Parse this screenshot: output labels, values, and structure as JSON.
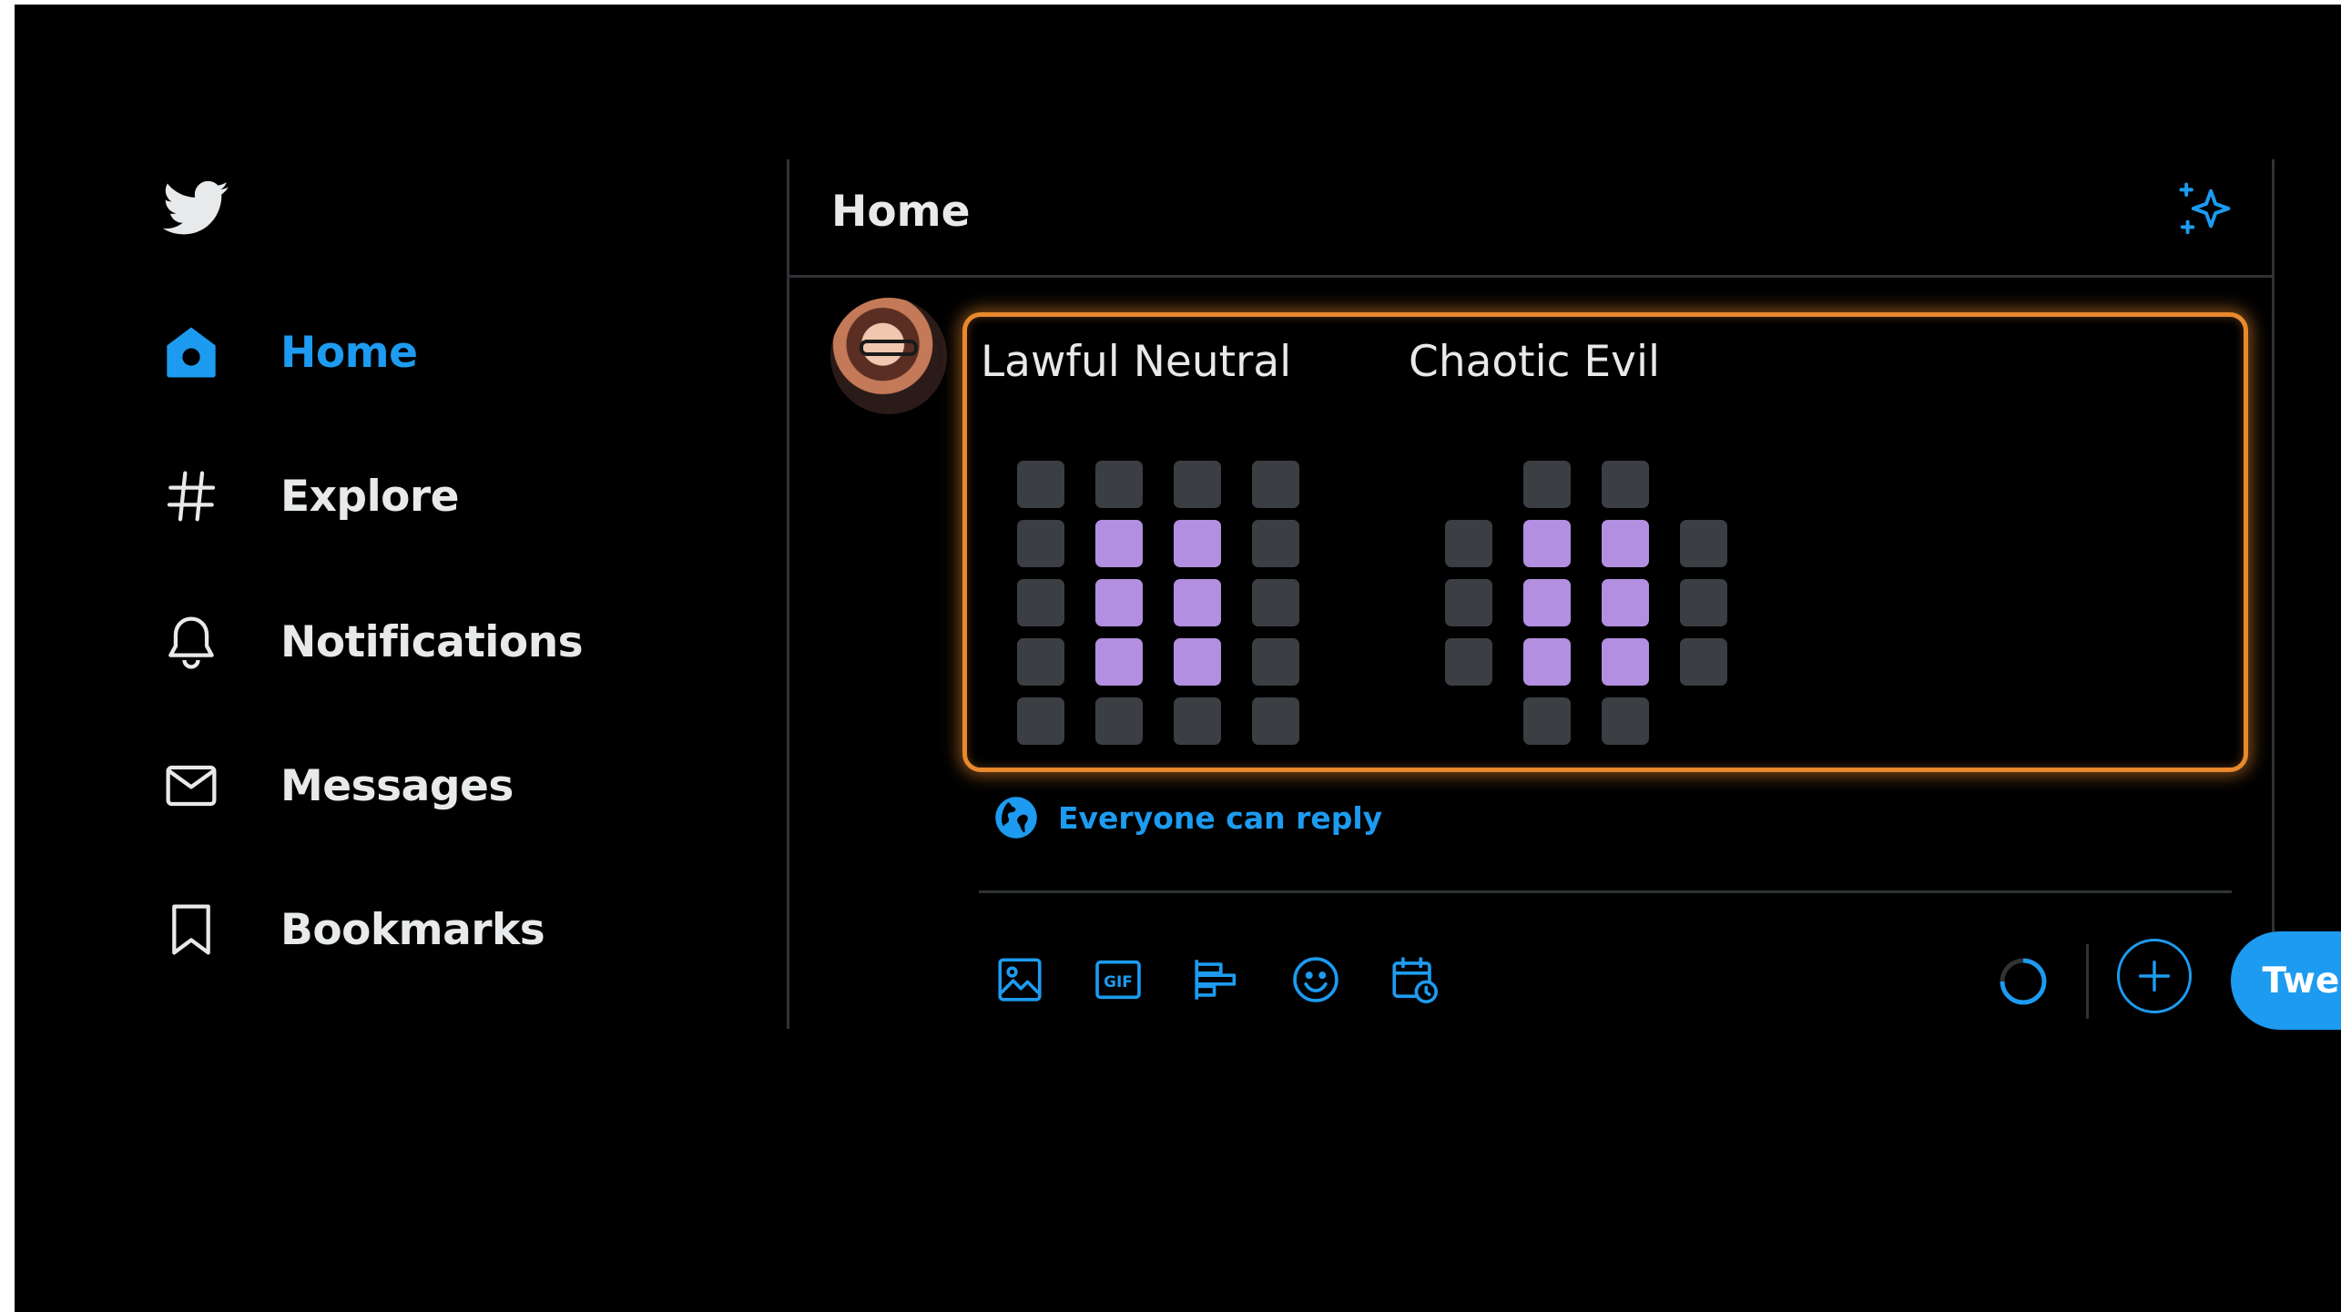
{
  "nav": {
    "items": [
      {
        "label": "Home",
        "icon": "home-icon",
        "active": true
      },
      {
        "label": "Explore",
        "icon": "hashtag-icon",
        "active": false
      },
      {
        "label": "Notifications",
        "icon": "bell-icon",
        "active": false
      },
      {
        "label": "Messages",
        "icon": "envelope-icon",
        "active": false
      },
      {
        "label": "Bookmarks",
        "icon": "bookmark-icon",
        "active": false
      }
    ]
  },
  "header": {
    "title": "Home"
  },
  "compose": {
    "alignments": [
      {
        "title": "Lawful Neutral",
        "grid": [
          [
            1,
            1,
            1,
            1
          ],
          [
            1,
            2,
            2,
            1
          ],
          [
            1,
            2,
            2,
            1
          ],
          [
            1,
            2,
            2,
            1
          ],
          [
            1,
            1,
            1,
            1
          ]
        ]
      },
      {
        "title": "Chaotic Evil",
        "grid": [
          [
            0,
            1,
            1,
            0
          ],
          [
            1,
            2,
            2,
            1
          ],
          [
            1,
            2,
            2,
            1
          ],
          [
            1,
            2,
            2,
            1
          ],
          [
            0,
            1,
            1,
            0
          ]
        ]
      }
    ],
    "reply_setting": "Everyone can reply",
    "tweet_button": "Tweet"
  },
  "colors": {
    "accent": "#1d9bf0",
    "highlight_border": "#e8892e",
    "cell_on": "#b28fe0",
    "cell_off": "#3b3e42",
    "background": "#000000"
  },
  "toolbar_icons": [
    "image-icon",
    "gif-icon",
    "poll-icon",
    "emoji-icon",
    "schedule-icon"
  ]
}
